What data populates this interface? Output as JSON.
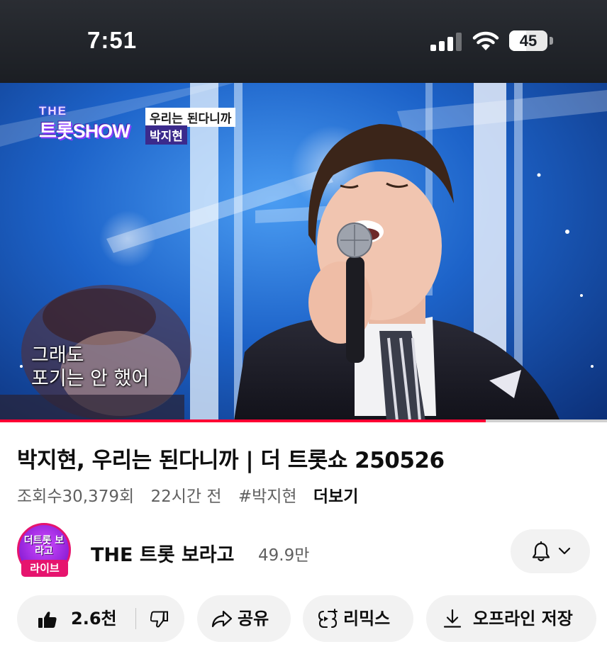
{
  "status_bar": {
    "time": "7:51",
    "battery": "45",
    "battery_fraction": 0.45
  },
  "video": {
    "show_logo_line1": "THE",
    "show_logo_line2": "트롯SHOW",
    "song_tag": "우리는 된다니까",
    "artist_tag": "박지현",
    "subtitle_line1": "그래도",
    "subtitle_line2": "포기는 안 했어",
    "progress_fraction": 0.8
  },
  "info": {
    "title": "박지현, 우리는 된다니까 | 더 트롯쇼 250526",
    "views": "조회수30,379회",
    "age": "22시간 전",
    "hashtag": "#박지현",
    "more": "더보기"
  },
  "channel": {
    "avatar_text": "더트롯 보라고",
    "avatar_badge": "라이브",
    "name": "THE 트롯 보라고",
    "subscribers": "49.9만"
  },
  "actions": {
    "like_count": "2.6천",
    "share": "공유",
    "remix": "리믹스",
    "download": "오프라인 저장"
  },
  "colors": {
    "accent_red": "#ff0033",
    "live_badge": "#e6146e",
    "pill_bg": "#f2f2f2"
  },
  "icons": [
    "signal-icon",
    "wifi-icon",
    "battery-icon",
    "bell-icon",
    "chevron-down-icon",
    "thumbs-up-icon",
    "thumbs-down-icon",
    "share-icon",
    "remix-icon",
    "download-icon"
  ]
}
